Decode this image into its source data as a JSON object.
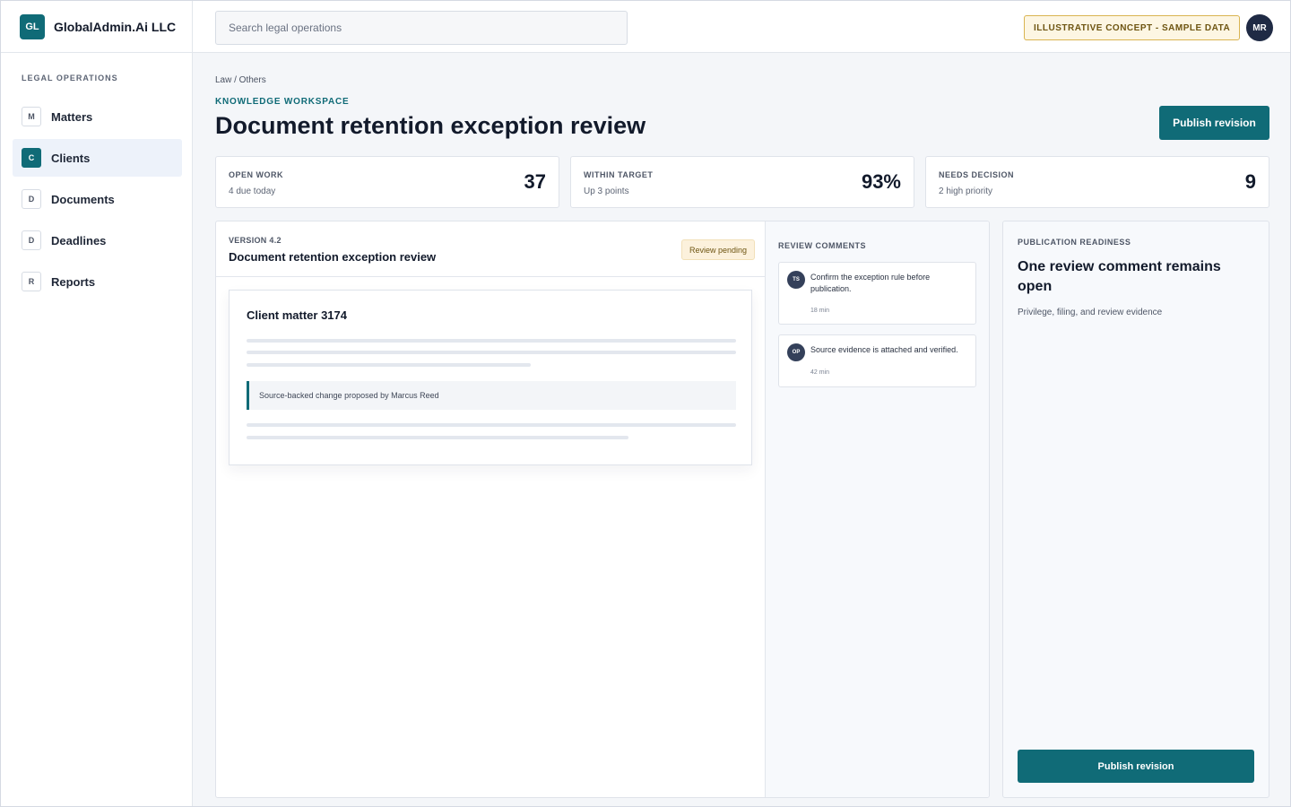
{
  "brand": {
    "logo": "GL",
    "name": "GlobalAdmin.Ai LLC"
  },
  "search": {
    "placeholder": "Search legal operations"
  },
  "concept_badge": "ILLUSTRATIVE CONCEPT - SAMPLE DATA",
  "user": {
    "initials": "MR"
  },
  "sidebar": {
    "heading": "LEGAL OPERATIONS",
    "items": [
      {
        "icon": "M",
        "label": "Matters",
        "active": false
      },
      {
        "icon": "C",
        "label": "Clients",
        "active": true
      },
      {
        "icon": "D",
        "label": "Documents",
        "active": false
      },
      {
        "icon": "D",
        "label": "Deadlines",
        "active": false
      },
      {
        "icon": "R",
        "label": "Reports",
        "active": false
      }
    ]
  },
  "header": {
    "breadcrumb": "Law / Others",
    "eyebrow": "KNOWLEDGE WORKSPACE",
    "title": "Document retention exception review",
    "publish_label": "Publish revision"
  },
  "stats": [
    {
      "label": "OPEN WORK",
      "sub": "4 due today",
      "value": "37"
    },
    {
      "label": "WITHIN TARGET",
      "sub": "Up 3 points",
      "value": "93%"
    },
    {
      "label": "NEEDS DECISION",
      "sub": "2 high priority",
      "value": "9"
    }
  ],
  "document": {
    "version": "VERSION 4.2",
    "title": "Document retention exception review",
    "status": "Review pending",
    "card_title": "Client matter 3174",
    "quote": "Source-backed change proposed by Marcus Reed"
  },
  "comments": {
    "heading": "REVIEW COMMENTS",
    "items": [
      {
        "initials": "TS",
        "text": "Confirm the exception rule before publication.",
        "time": "18 min"
      },
      {
        "initials": "OP",
        "text": "Source evidence is attached and verified.",
        "time": "42 min"
      }
    ]
  },
  "readiness": {
    "heading": "PUBLICATION READINESS",
    "title": "One review comment remains open",
    "sub": "Privilege, filing, and review evidence",
    "publish_label": "Publish revision"
  },
  "colors": {
    "accent": "#106b77",
    "badge_bg": "#fdf6e3",
    "badge_border": "#d9b451",
    "avatar": "#1f2a44"
  }
}
